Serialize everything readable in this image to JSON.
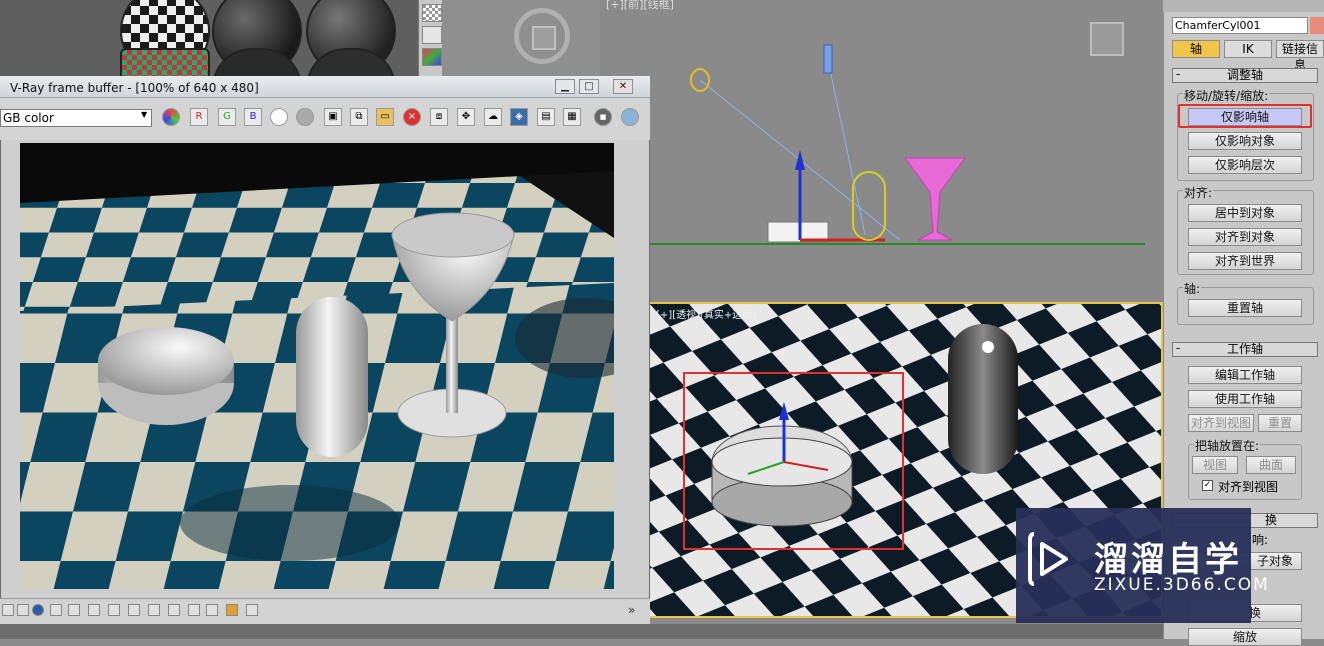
{
  "vfb": {
    "title": "V-Ray frame buffer - [100% of 640 x 480]",
    "channel": "GB color",
    "minimize": "▁",
    "maximize": "□",
    "close": "✕"
  },
  "front_viewport": {
    "label": "[+][前][线框]"
  },
  "persp_viewport": {
    "label": "[+][透视][真实+边面]"
  },
  "command_panel": {
    "object_name": "ChamferCyl001",
    "object_color": "#e98c7b",
    "tabs": [
      "轴",
      "IK",
      "链接信息"
    ],
    "adjust_pivot": {
      "title": "调整轴",
      "move_group_label": "移动/旋转/缩放:",
      "affect_pivot_only": "仅影响轴",
      "affect_object_only": "仅影响对象",
      "affect_hierarchy_only": "仅影响层次",
      "align_label": "对齐:",
      "center_to_object": "居中到对象",
      "align_to_object": "对齐到对象",
      "align_to_world": "对齐到世界",
      "pivot_label": "轴:",
      "reset_pivot": "重置轴"
    },
    "working_pivot": {
      "title": "工作轴",
      "edit_working_pivot": "编辑工作轴",
      "use_working_pivot": "使用工作轴",
      "align_to_view": "对齐到视图",
      "reset": "重置",
      "place_pivot_label": "把轴放置在:",
      "view": "视图",
      "surface": "曲面",
      "align_to_view_check": "对齐到视图",
      "checked": "✓"
    },
    "adjust_transform": {
      "title_partial": "换",
      "line1_partial": "响:",
      "btn_partial": "子对象",
      "btn2_partial": "换",
      "btn3_partial": "缩放"
    }
  },
  "watermark": {
    "title": "溜溜自学",
    "url": "ZIXUE.3D66.COM"
  },
  "icons": [
    "play-logo-icon",
    "channel-dropdown-icon",
    "window-minimize-icon",
    "window-maximize-icon",
    "window-close-icon"
  ]
}
